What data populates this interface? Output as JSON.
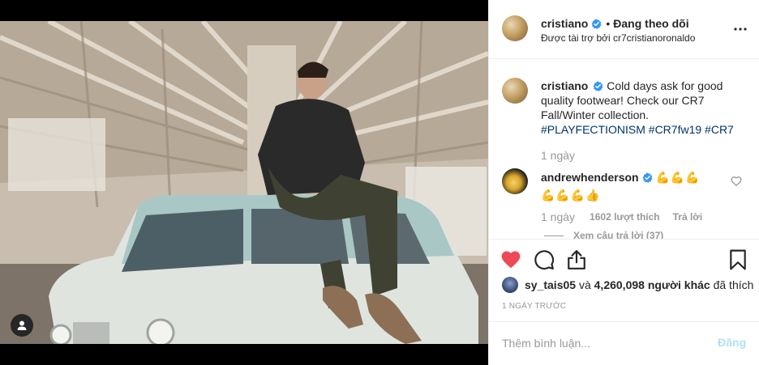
{
  "post": {
    "author": "cristiano",
    "follow_status": "Đang theo dõi",
    "sponsored_label": "Được tài trợ bởi cr7cristianoronaldo",
    "caption_text": "Cold days ask for good quality footwear! Check our CR7 Fall/Winter collection.",
    "hashtags": [
      "#PLAYFECTIONISM",
      "#CR7fw19",
      "#CR7"
    ],
    "caption_age": "1 ngày",
    "timestamp": "1 NGÀY TRƯỚC"
  },
  "top_comment": {
    "user": "andrewhenderson",
    "text_line1": "💪💪💪",
    "text_line2": "💪💪💪👍",
    "age": "1 ngày",
    "likes": "1602 lượt thích",
    "reply_label": "Trả lời",
    "view_replies": "Xem câu trả lời (37)"
  },
  "likes_summary": {
    "user": "sy_tais05",
    "connector": "và",
    "others": "4,260,098 người khác",
    "suffix": "đã thích"
  },
  "comment_form": {
    "placeholder": "Thêm bình luận...",
    "post_label": "Đăng"
  },
  "icons": {
    "verified": "verified-badge-icon",
    "more": "more-options-icon",
    "like": "heart-filled-icon",
    "comment": "comment-bubble-icon",
    "share": "share-icon",
    "save": "bookmark-icon",
    "user_tag": "user-tag-icon"
  },
  "colors": {
    "liked_heart": "#ed4956",
    "verified": "#3897f0",
    "hashtag": "#003569",
    "muted": "#999999",
    "post_button_disabled": "#b2dffc"
  }
}
